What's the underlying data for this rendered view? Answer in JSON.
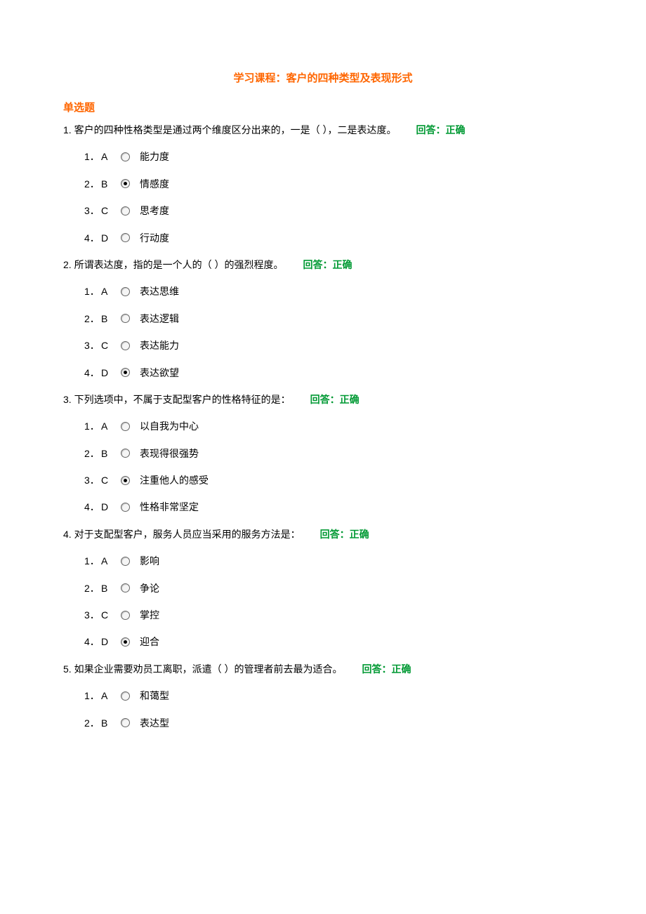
{
  "course_title": "学习课程：客户的四种类型及表现形式",
  "section_heading": "单选题",
  "answer_label_prefix": "回答：",
  "answer_label_status": "正确",
  "questions": [
    {
      "number": "1.",
      "text": "客户的四种性格类型是通过两个维度区分出来的，一是（ ），二是表达度。",
      "selected": 1,
      "options": [
        {
          "num": "1．",
          "letter": "A",
          "label": "能力度"
        },
        {
          "num": "2．",
          "letter": "B",
          "label": "情感度"
        },
        {
          "num": "3．",
          "letter": "C",
          "label": "思考度"
        },
        {
          "num": "4．",
          "letter": "D",
          "label": "行动度"
        }
      ]
    },
    {
      "number": "2.",
      "text": "所谓表达度，指的是一个人的（ ）的强烈程度。",
      "selected": 3,
      "options": [
        {
          "num": "1．",
          "letter": "A",
          "label": "表达思维"
        },
        {
          "num": "2．",
          "letter": "B",
          "label": "表达逻辑"
        },
        {
          "num": "3．",
          "letter": "C",
          "label": "表达能力"
        },
        {
          "num": "4．",
          "letter": "D",
          "label": "表达欲望"
        }
      ]
    },
    {
      "number": "3.",
      "text": "下列选项中，不属于支配型客户的性格特征的是：",
      "selected": 2,
      "options": [
        {
          "num": "1．",
          "letter": "A",
          "label": "以自我为中心"
        },
        {
          "num": "2．",
          "letter": "B",
          "label": "表现得很强势"
        },
        {
          "num": "3．",
          "letter": "C",
          "label": "注重他人的感受"
        },
        {
          "num": "4．",
          "letter": "D",
          "label": "性格非常坚定"
        }
      ]
    },
    {
      "number": "4.",
      "text": "对于支配型客户，服务人员应当采用的服务方法是：",
      "selected": 3,
      "options": [
        {
          "num": "1．",
          "letter": "A",
          "label": "影响"
        },
        {
          "num": "2．",
          "letter": "B",
          "label": "争论"
        },
        {
          "num": "3．",
          "letter": "C",
          "label": "掌控"
        },
        {
          "num": "4．",
          "letter": "D",
          "label": "迎合"
        }
      ]
    },
    {
      "number": "5.",
      "text": "如果企业需要劝员工离职，派遣（ ）的管理者前去最为适合。",
      "selected": -1,
      "options": [
        {
          "num": "1．",
          "letter": "A",
          "label": "和蔼型"
        },
        {
          "num": "2．",
          "letter": "B",
          "label": "表达型"
        }
      ]
    }
  ]
}
